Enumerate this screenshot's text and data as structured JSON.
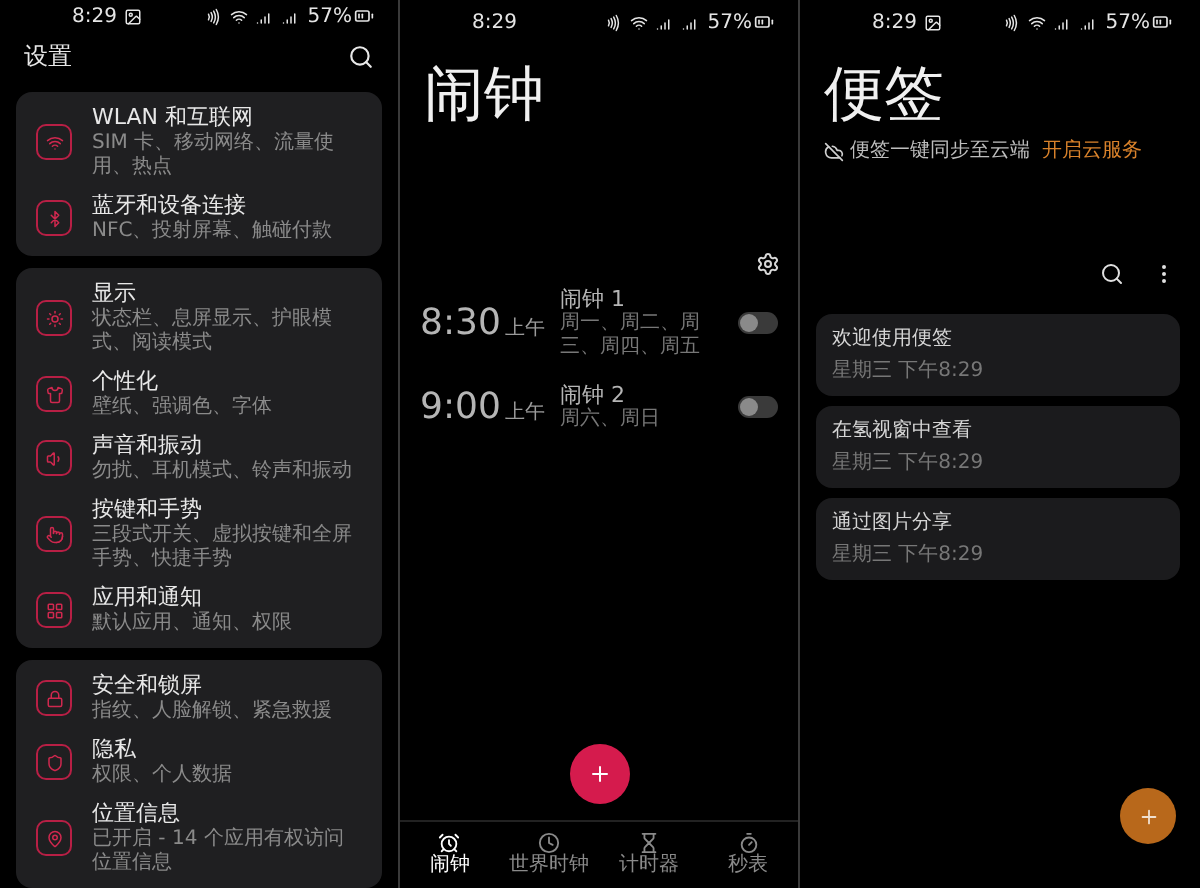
{
  "settings": {
    "status_bar": {
      "time": "8:29",
      "battery": "57%"
    },
    "title": "设置",
    "groups": [
      {
        "items": [
          {
            "title": "WLAN 和互联网",
            "subtitle": "SIM 卡、移动网络、流量使用、热点"
          },
          {
            "title": "蓝牙和设备连接",
            "subtitle": "NFC、投射屏幕、触碰付款"
          }
        ]
      },
      {
        "items": [
          {
            "title": "显示",
            "subtitle": "状态栏、息屏显示、护眼模式、阅读模式"
          },
          {
            "title": "个性化",
            "subtitle": "壁纸、强调色、字体"
          },
          {
            "title": "声音和振动",
            "subtitle": "勿扰、耳机模式、铃声和振动"
          },
          {
            "title": "按键和手势",
            "subtitle": "三段式开关、虚拟按键和全屏手势、快捷手势"
          },
          {
            "title": "应用和通知",
            "subtitle": "默认应用、通知、权限"
          }
        ]
      },
      {
        "items": [
          {
            "title": "安全和锁屏",
            "subtitle": "指纹、人脸解锁、紧急救援"
          },
          {
            "title": "隐私",
            "subtitle": "权限、个人数据"
          },
          {
            "title": "位置信息",
            "subtitle": "已开启 - 14 个应用有权访问位置信息"
          }
        ]
      }
    ]
  },
  "clock": {
    "status_bar": {
      "time": "8:29",
      "battery": "57%"
    },
    "title": "闹钟",
    "alarms": [
      {
        "time": "8:30",
        "period": "上午",
        "name": "闹钟 1",
        "days": "周一、周二、周三、周四、周五",
        "on": false
      },
      {
        "time": "9:00",
        "period": "上午",
        "name": "闹钟 2",
        "days": "周六、周日",
        "on": false
      }
    ],
    "nav": [
      {
        "label": "闹钟",
        "selected": true
      },
      {
        "label": "世界时钟",
        "selected": false
      },
      {
        "label": "计时器",
        "selected": false
      },
      {
        "label": "秒表",
        "selected": false
      }
    ]
  },
  "notes": {
    "status_bar": {
      "time": "8:29",
      "battery": "57%"
    },
    "title": "便签",
    "sync_notice": "便签一键同步至云端",
    "sync_link": "开启云服务",
    "items": [
      {
        "title": "欢迎使用便签",
        "date": "星期三 下午8:29"
      },
      {
        "title": "在氢视窗中查看",
        "date": "星期三 下午8:29"
      },
      {
        "title": "通过图片分享",
        "date": "星期三 下午8:29"
      }
    ]
  }
}
